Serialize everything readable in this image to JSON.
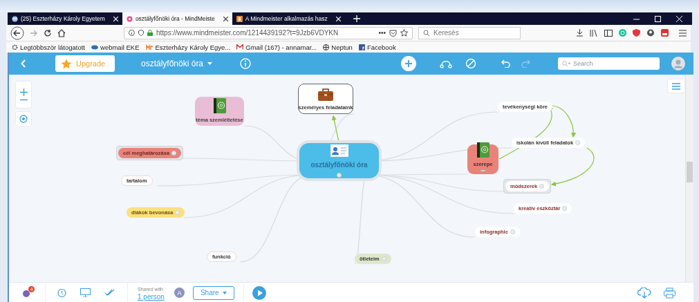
{
  "browser": {
    "tabs": [
      {
        "label": "(25) Eszterházy Károly Egyetem",
        "selected": false
      },
      {
        "label": "osztályfőnöki óra - MindMeiste",
        "selected": true
      },
      {
        "label": "A Mindmeister alkalmazás hasz",
        "selected": false
      }
    ],
    "url": "https://www.mindmeister.com/1214439192?t=9Jzb6VDYKN",
    "page_actions": "•••",
    "search": {
      "placeholder": "Keresés"
    },
    "bookmarks": [
      {
        "label": "Legtöbbször látogatott"
      },
      {
        "label": "webmail EKE"
      },
      {
        "label": "Eszterházy Károly Egye..."
      },
      {
        "label": "Gmail (167) - annamar..."
      },
      {
        "label": "Neptun"
      },
      {
        "label": "Facebook"
      }
    ]
  },
  "app_bar": {
    "upgrade": "Upgrade",
    "map_title": "osztályfőnöki óra",
    "undo": {
      "disabled": false
    },
    "redo": {
      "disabled": true
    },
    "search": {
      "placeholder": "Search"
    }
  },
  "mind_map": {
    "nodes": [
      {
        "label": "személyes feladataink",
        "kind": "image",
        "color": "#ffffff"
      },
      {
        "label": "téma szemléltetése",
        "kind": "image",
        "color": "#e9bdd5"
      },
      {
        "label": "tevékenységi köre",
        "kind": "topic",
        "color": "#ffffff",
        "framed": false
      },
      {
        "label": "cél meghatározása",
        "kind": "topic",
        "color": "#e9837a",
        "framed": true
      },
      {
        "label": "iskolán kívüli feladatok",
        "kind": "topic",
        "color": "#ffffff",
        "framed": false
      },
      {
        "label": "osztályfőnöki óra",
        "kind": "central",
        "color": "#4bbde8"
      },
      {
        "label": "szerepe",
        "kind": "image",
        "color": "#e9837a"
      },
      {
        "label": "tartalom",
        "kind": "topic",
        "color": "#ffffff",
        "framed": false
      },
      {
        "label": "módszerek",
        "kind": "topic",
        "color": "#ffffff",
        "framed": true
      },
      {
        "label": "kreatív eszköztár",
        "kind": "topic",
        "color": "#ffffff",
        "framed": false
      },
      {
        "label": "diákok bevonása",
        "kind": "topic",
        "color": "#fbe07c",
        "framed": false
      },
      {
        "label": "infographic",
        "kind": "topic",
        "color": "#ffffff",
        "framed": false
      },
      {
        "label": "funkció",
        "kind": "topic",
        "color": "#ffffff",
        "framed": false
      },
      {
        "label": "ötleteim",
        "kind": "topic",
        "color": "#dde8cb",
        "framed": false
      }
    ]
  },
  "bottom_bar": {
    "badge": "4",
    "shared_label": "Shared with",
    "shared_link": "1 person",
    "avatar": "A",
    "share": "Share"
  }
}
